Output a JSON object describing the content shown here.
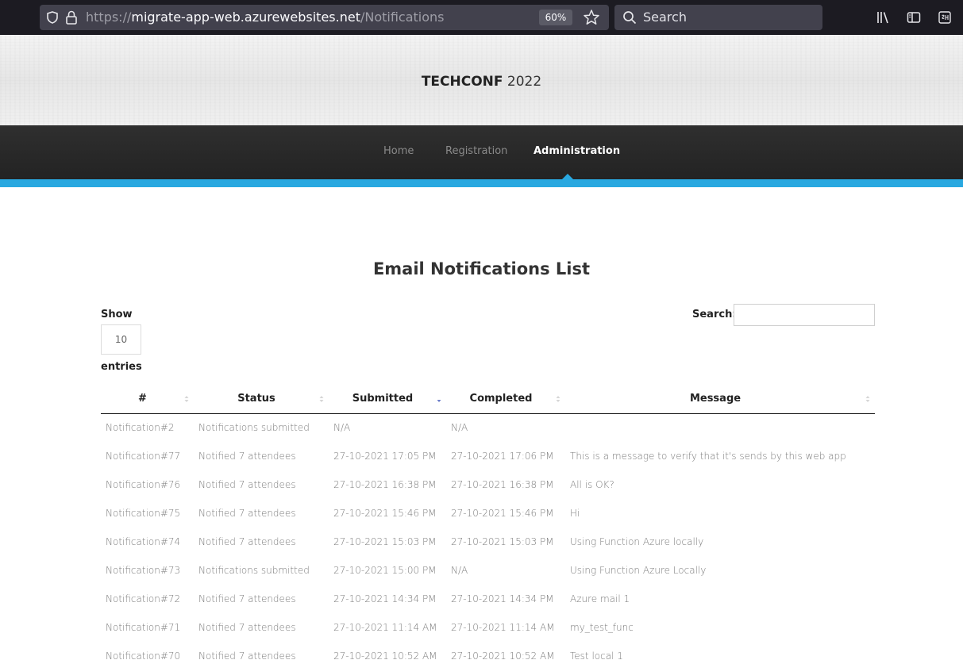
{
  "browser": {
    "url_protocol": "https://",
    "url_host": "migrate-app-web.azurewebsites.net",
    "url_path": "/Notifications",
    "zoom": "60%",
    "search_placeholder": "Search",
    "icons": [
      "shield-icon",
      "lock-icon",
      "star-icon",
      "search-icon",
      "library-icon",
      "sidebar-icon",
      "extension-icon"
    ]
  },
  "site": {
    "brand_bold": "TECHCONF",
    "brand_year": " 2022"
  },
  "nav": {
    "items": [
      {
        "label": "Home"
      },
      {
        "label": "Registration"
      },
      {
        "label": "Administration",
        "active": true
      }
    ],
    "accent_color": "#29a8e0"
  },
  "page": {
    "title": "Email Notifications List",
    "show_label": "Show",
    "page_length": "10",
    "entries_label": "entries",
    "search_label": "Search:",
    "search_value": ""
  },
  "table": {
    "columns": [
      "#",
      "Status",
      "Submitted",
      "Completed",
      "Message"
    ],
    "sorted_column": "Submitted",
    "rows": [
      [
        "Notification#2",
        "Notifications submitted",
        "N/A",
        "N/A",
        ""
      ],
      [
        "Notification#77",
        "Notified 7 attendees",
        "27-10-2021 17:05 PM",
        "27-10-2021 17:06 PM",
        "This is a message to verify that it's sends by this web app"
      ],
      [
        "Notification#76",
        "Notified 7 attendees",
        "27-10-2021 16:38 PM",
        "27-10-2021 16:38 PM",
        "All is OK?"
      ],
      [
        "Notification#75",
        "Notified 7 attendees",
        "27-10-2021 15:46 PM",
        "27-10-2021 15:46 PM",
        "Hi"
      ],
      [
        "Notification#74",
        "Notified 7 attendees",
        "27-10-2021 15:03 PM",
        "27-10-2021 15:03 PM",
        "Using Function Azure locally"
      ],
      [
        "Notification#73",
        "Notifications submitted",
        "27-10-2021 15:00 PM",
        "N/A",
        "Using Function Azure Locally"
      ],
      [
        "Notification#72",
        "Notified 7 attendees",
        "27-10-2021 14:34 PM",
        "27-10-2021 14:34 PM",
        "Azure mail 1"
      ],
      [
        "Notification#71",
        "Notified 7 attendees",
        "27-10-2021 11:14 AM",
        "27-10-2021 11:14 AM",
        "my_test_func"
      ],
      [
        "Notification#70",
        "Notified 7 attendees",
        "27-10-2021 10:52 AM",
        "27-10-2021 10:52 AM",
        "Test local 1"
      ]
    ]
  }
}
